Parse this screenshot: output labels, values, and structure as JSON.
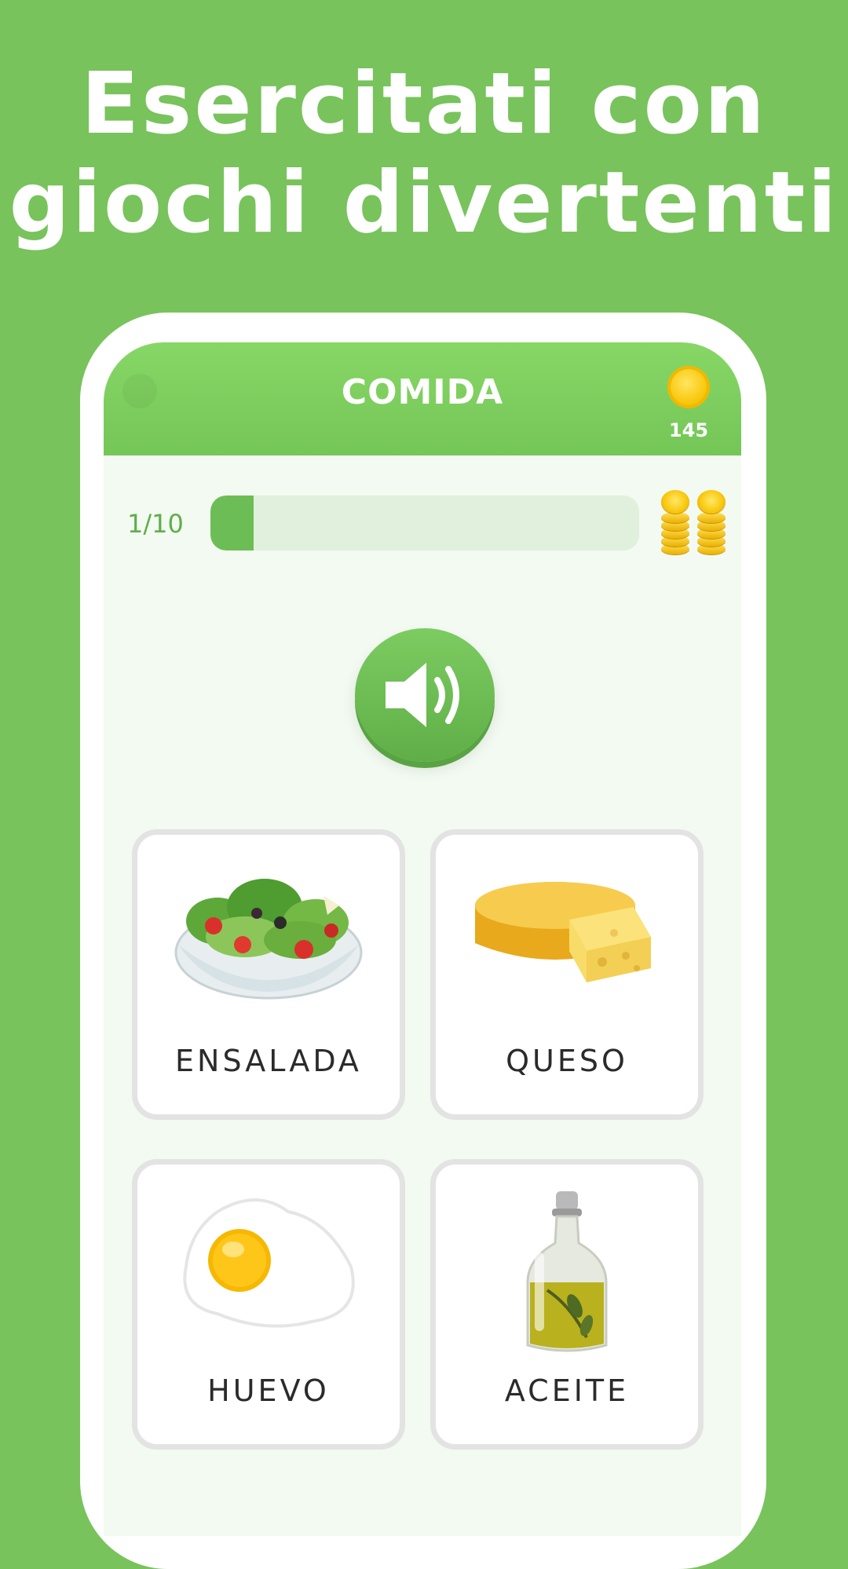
{
  "headline": {
    "line1": "Esercitati con",
    "line2": "giochi divertenti"
  },
  "game": {
    "title": "COMIDA",
    "coins": "145",
    "progress_label": "1/10",
    "progress_fraction": 0.1
  },
  "options": [
    {
      "label": "ENSALADA",
      "icon": "salad-icon"
    },
    {
      "label": "QUESO",
      "icon": "cheese-icon"
    },
    {
      "label": "HUEVO",
      "icon": "fried-egg-icon"
    },
    {
      "label": "ACEITE",
      "icon": "oil-bottle-icon"
    }
  ],
  "colors": {
    "background": "#78c35c",
    "accent": "#6dbd56",
    "card_border": "#e3e3e3"
  }
}
